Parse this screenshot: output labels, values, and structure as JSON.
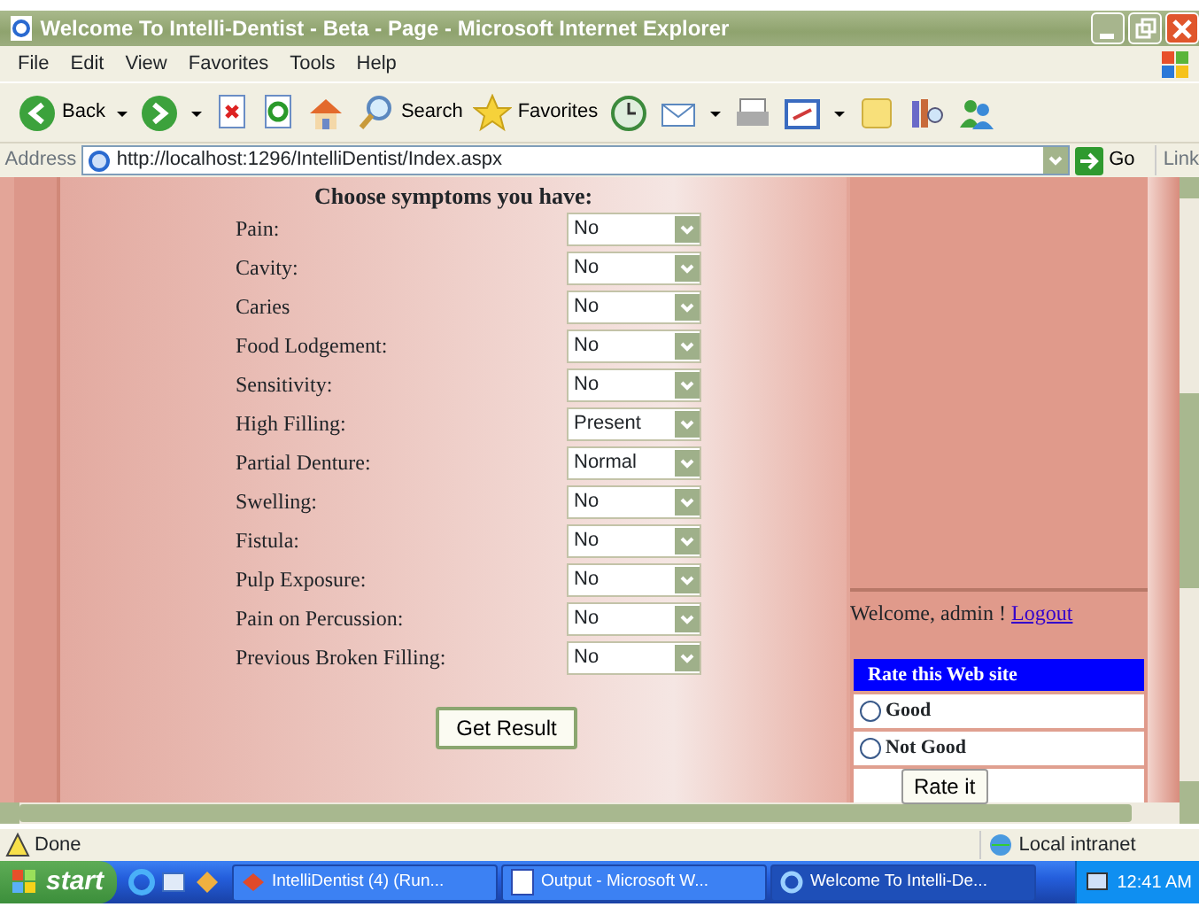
{
  "window": {
    "title": "Welcome To Intelli-Dentist - Beta - Page - Microsoft Internet Explorer"
  },
  "menu": [
    "File",
    "Edit",
    "View",
    "Favorites",
    "Tools",
    "Help"
  ],
  "toolbar": [
    {
      "kind": "back",
      "label": "Back",
      "dropdown": true
    },
    {
      "kind": "forward",
      "dropdown": true
    },
    {
      "kind": "stop"
    },
    {
      "kind": "refresh"
    },
    {
      "kind": "home"
    },
    {
      "kind": "search",
      "label": "Search"
    },
    {
      "kind": "favorites",
      "label": "Favorites"
    },
    {
      "kind": "history"
    },
    {
      "kind": "mail",
      "dropdown": true
    },
    {
      "kind": "print"
    },
    {
      "kind": "edit",
      "dropdown": true
    },
    {
      "kind": "note"
    },
    {
      "kind": "research"
    },
    {
      "kind": "messenger"
    }
  ],
  "address_bar": {
    "label": "Address",
    "url": "http://localhost:1296/IntelliDentist/Index.aspx",
    "go": "Go",
    "links": "Link"
  },
  "form": {
    "heading": "Choose symptoms you have:",
    "symptoms": [
      {
        "label": "Pain:",
        "value": "No"
      },
      {
        "label": "Cavity:",
        "value": "No"
      },
      {
        "label": "Caries",
        "value": "No"
      },
      {
        "label": "Food Lodgement:",
        "value": "No"
      },
      {
        "label": "Sensitivity:",
        "value": "No"
      },
      {
        "label": "High Filling:",
        "value": "Present"
      },
      {
        "label": "Partial Denture:",
        "value": "Normal"
      },
      {
        "label": "Swelling:",
        "value": "No"
      },
      {
        "label": "Fistula:",
        "value": "No"
      },
      {
        "label": "Pulp Exposure:",
        "value": "No"
      },
      {
        "label": "Pain on Percussion:",
        "value": "No"
      },
      {
        "label": "Previous Broken Filling:",
        "value": "No"
      }
    ],
    "submit": "Get Result"
  },
  "sidebar": {
    "welcome": "Welcome, admin !",
    "logout": "Logout",
    "rating": {
      "title": "Rate this Web site",
      "options": [
        {
          "label": "Good",
          "selected": false
        },
        {
          "label": "Not Good",
          "selected": false
        }
      ],
      "button": "Rate it"
    }
  },
  "status_bar": {
    "text": "Done",
    "zone": "Local intranet"
  },
  "taskbar": {
    "start": "start",
    "quick_launch": [
      {
        "kind": "ie"
      },
      {
        "kind": "outlook"
      },
      {
        "kind": "media"
      }
    ],
    "tasks": [
      {
        "label": "IntelliDentist (4) (Run...",
        "kind": "vs",
        "selected": false
      },
      {
        "label": "Output - Microsoft W...",
        "kind": "word",
        "selected": false
      },
      {
        "label": "Welcome To Intelli-De...",
        "kind": "ie",
        "selected": true
      }
    ],
    "clock": "12:41 AM"
  }
}
